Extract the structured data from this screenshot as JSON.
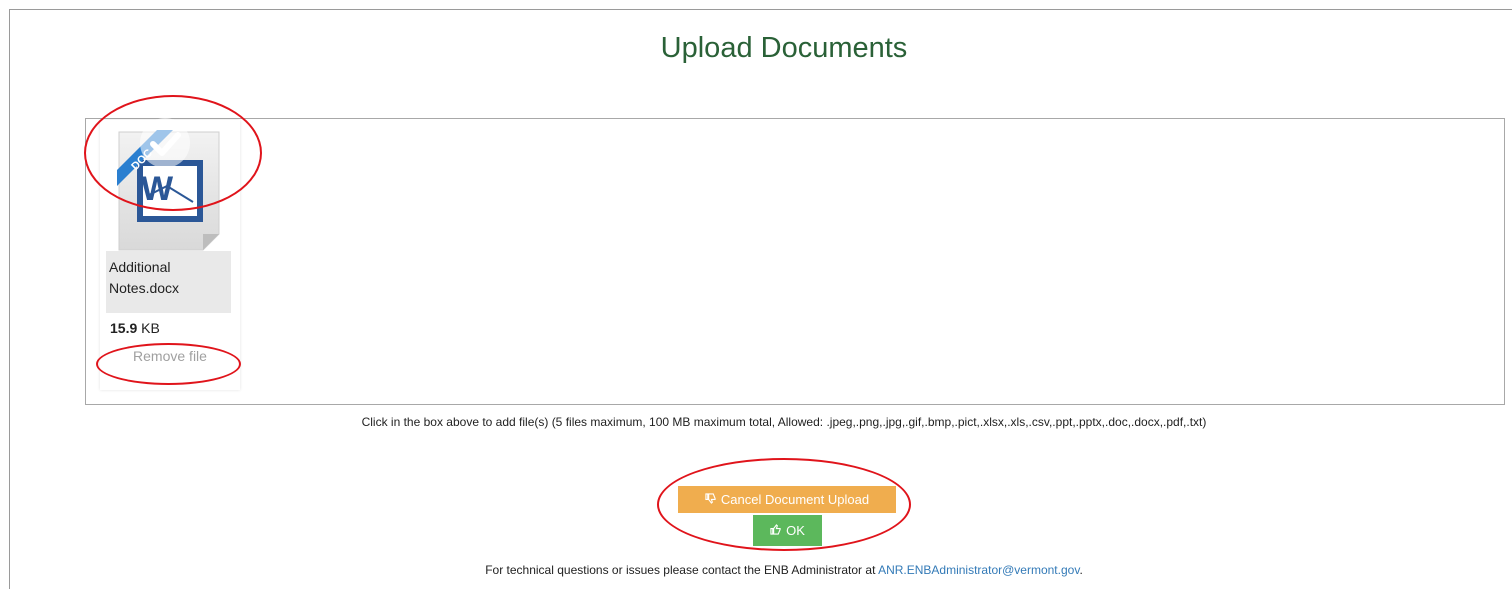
{
  "page": {
    "title": "Upload Documents"
  },
  "file": {
    "name": "Additional Notes.docx",
    "size_value": "15.9",
    "size_unit": "KB",
    "remove_label": "Remove file",
    "thumbnail_icon": "word-document-icon",
    "ribbon_label": "DOC"
  },
  "help": {
    "text": "Click in the box above to add file(s) (5 files maximum, 100 MB maximum total, Allowed: .jpeg,.png,.jpg,.gif,.bmp,.pict,.xlsx,.xls,.csv,.ppt,.pptx,.doc,.docx,.pdf,.txt)"
  },
  "actions": {
    "cancel_label": "Cancel Document Upload",
    "cancel_icon": "thumbs-down-icon",
    "ok_label": "OK",
    "ok_icon": "thumbs-up-icon"
  },
  "footer": {
    "text": "For technical questions or issues please contact the ENB Administrator at ",
    "email": "ANR.ENBAdministrator@vermont.gov",
    "trailing": "."
  },
  "colors": {
    "title": "#2a6137",
    "cancel_button": "#f0ad4e",
    "ok_button": "#5cb85c",
    "link": "#337ab7",
    "annotation": "#e0141b"
  }
}
